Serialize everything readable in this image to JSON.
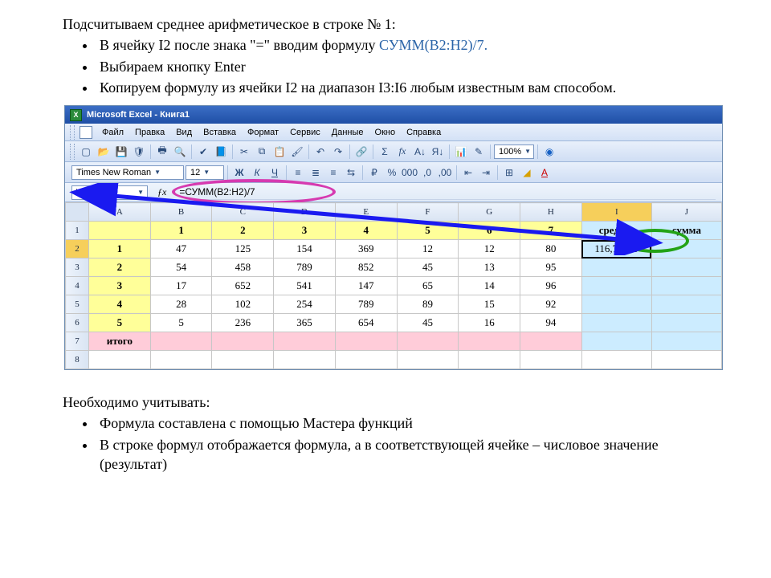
{
  "top_text": {
    "line1": "Подсчитываем среднее арифметическое в строке № 1:",
    "b1_pre": "В ячейку I2 после знака \"=\" вводим формулу ",
    "b1_formula": "СУММ(B2:H2)/7.",
    "b2": "Выбираем кнопку Enter",
    "b3": "Копируем формулу из ячейки I2 на диапазон I3:I6 любым известным вам способом."
  },
  "bottom_text": {
    "line1": "Необходимо учитывать:",
    "b1": "Формула составлена с помощью Мастера функций",
    "b2": "В строке формул отображается формула, а в соответствующей ячейке – числовое значение (результат)"
  },
  "excel": {
    "title": "Microsoft Excel - Книга1",
    "menu": [
      "Файл",
      "Правка",
      "Вид",
      "Вставка",
      "Формат",
      "Сервис",
      "Данные",
      "Окно",
      "Справка"
    ],
    "font_name": "Times New Roman",
    "font_size": "12",
    "zoom": "100%",
    "namebox": "I2",
    "formula": "=СУММ(B2:H2)/7",
    "columns": [
      "A",
      "B",
      "C",
      "D",
      "E",
      "F",
      "G",
      "H",
      "I",
      "J"
    ],
    "row_headers": [
      "1",
      "2",
      "3",
      "4",
      "5",
      "6",
      "7",
      "8"
    ],
    "header_row": {
      "i": "среднее",
      "j": "сумма"
    },
    "data": [
      {
        "a": "1",
        "cells": [
          "47",
          "125",
          "154",
          "369",
          "12",
          "12",
          "80"
        ],
        "i": "116,71429"
      },
      {
        "a": "2",
        "cells": [
          "54",
          "458",
          "789",
          "852",
          "45",
          "13",
          "95"
        ],
        "i": ""
      },
      {
        "a": "3",
        "cells": [
          "17",
          "652",
          "541",
          "147",
          "65",
          "14",
          "96"
        ],
        "i": ""
      },
      {
        "a": "4",
        "cells": [
          "28",
          "102",
          "254",
          "789",
          "89",
          "15",
          "92"
        ],
        "i": ""
      },
      {
        "a": "5",
        "cells": [
          "5",
          "236",
          "365",
          "654",
          "45",
          "16",
          "94"
        ],
        "i": ""
      }
    ],
    "itogo": "итого"
  }
}
